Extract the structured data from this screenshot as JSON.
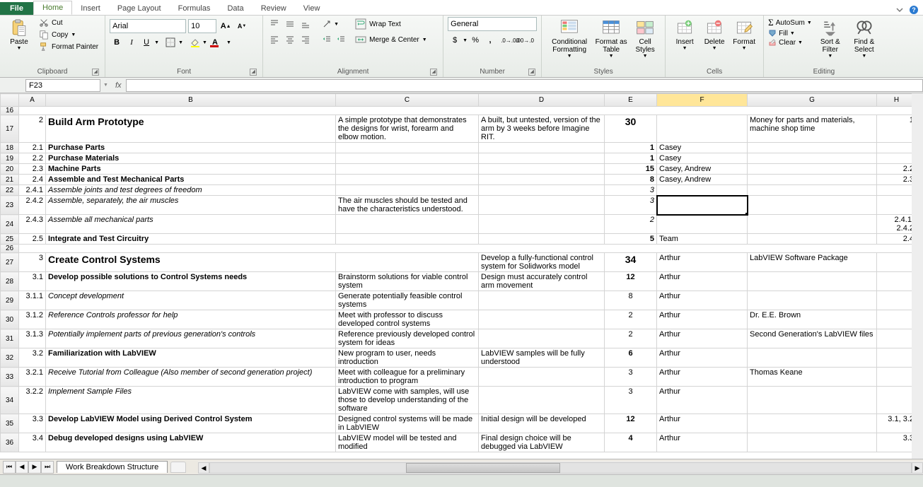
{
  "tabs": {
    "file": "File",
    "home": "Home",
    "insert": "Insert",
    "page_layout": "Page Layout",
    "formulas": "Formulas",
    "data": "Data",
    "review": "Review",
    "view": "View"
  },
  "clipboard": {
    "paste": "Paste",
    "cut": "Cut",
    "copy": "Copy",
    "format_painter": "Format Painter",
    "group": "Clipboard"
  },
  "font": {
    "name": "Arial",
    "size": "10",
    "group": "Font"
  },
  "alignment": {
    "wrap": "Wrap Text",
    "merge": "Merge & Center",
    "group": "Alignment"
  },
  "number": {
    "format": "General",
    "group": "Number"
  },
  "styles": {
    "cond": "Conditional Formatting",
    "table": "Format as Table",
    "cell": "Cell Styles",
    "group": "Styles"
  },
  "cells": {
    "insert": "Insert",
    "delete": "Delete",
    "format": "Format",
    "group": "Cells"
  },
  "editing": {
    "autosum": "AutoSum",
    "fill": "Fill",
    "clear": "Clear",
    "sort": "Sort & Filter",
    "find": "Find & Select",
    "group": "Editing"
  },
  "namebox": "F23",
  "sheet_tab": "Work Breakdown Structure",
  "cols": [
    "",
    "A",
    "B",
    "C",
    "D",
    "E",
    "F",
    "G",
    "H"
  ],
  "rows": [
    {
      "r": "16",
      "hatch": true
    },
    {
      "r": "17",
      "A": "2",
      "B": "Build Arm Prototype",
      "B_cls": "big",
      "C": "A simple prototype that demonstrates the designs for wrist, forearm and elbow motion.",
      "D": "A built, but untested, version of the arm by 3 weeks before Imagine RIT.",
      "E": "30",
      "E_cls": "biggerE",
      "G": "Money for parts and materials, machine shop time",
      "H": "1"
    },
    {
      "r": "18",
      "A": "2.1",
      "B": "Purchase Parts",
      "B_cls": "bold",
      "E": "1",
      "E_cls": "num bold",
      "F": "Casey"
    },
    {
      "r": "19",
      "A": "2.2",
      "B": "Purchase Materials",
      "B_cls": "bold",
      "E": "1",
      "E_cls": "num bold",
      "F": "Casey"
    },
    {
      "r": "20",
      "A": "2.3",
      "B": "Machine Parts",
      "B_cls": "bold",
      "E": "15",
      "E_cls": "num bold",
      "F": "Casey, Andrew",
      "H": "2.2"
    },
    {
      "r": "21",
      "A": "2.4",
      "B": "Assemble and Test Mechanical Parts",
      "B_cls": "bold",
      "E": "8",
      "E_cls": "num bold",
      "F": "Casey, Andrew",
      "H": "2.3"
    },
    {
      "r": "22",
      "A": "2.4.1",
      "B": "Assemble joints and test degrees of freedom",
      "B_cls": "ital indent",
      "E": "3",
      "E_cls": "num ital"
    },
    {
      "r": "23",
      "A": "2.4.2",
      "B": "Assemble, separately, the air muscles",
      "B_cls": "ital indent",
      "C": "The air muscles should be tested and have the characteristics understood.",
      "E": "3",
      "E_cls": "num ital",
      "sel": true
    },
    {
      "r": "24",
      "A": "2.4.3",
      "B": "Assemble all mechanical parts",
      "B_cls": "ital indent",
      "E": "2",
      "E_cls": "num ital",
      "H": "2.4.1, 2.4.2"
    },
    {
      "r": "25",
      "A": "2.5",
      "B": "Integrate and Test Circuitry",
      "B_cls": "bold",
      "E": "5",
      "E_cls": "num bold",
      "F": "Team",
      "H": "2.4"
    },
    {
      "r": "26",
      "hatch": true
    },
    {
      "r": "27",
      "A": "3",
      "B": "Create Control Systems",
      "B_cls": "big",
      "D": "Develop a fully-functional control system for Solidworks model",
      "E": "34",
      "E_cls": "biggerE",
      "F": "Arthur",
      "G": "LabVIEW Software Package"
    },
    {
      "r": "28",
      "A": "3.1",
      "B": "Develop possible solutions to Control Systems needs",
      "B_cls": "bold",
      "C": "Brainstorm solutions for viable control system",
      "D": "Design must accurately control arm movement",
      "E": "12",
      "E_cls": "ctr bold",
      "F": "Arthur"
    },
    {
      "r": "29",
      "A": "3.1.1",
      "B": "Concept development",
      "B_cls": "ital indent",
      "C": "Generate potentially feasible control systems",
      "E": "8",
      "E_cls": "ctr",
      "F": "Arthur"
    },
    {
      "r": "30",
      "A": "3.1.2",
      "B": "Reference Controls professor for help",
      "B_cls": "ital indent",
      "C": "Meet with professor to discuss developed control systems",
      "E": "2",
      "E_cls": "ctr",
      "F": "Arthur",
      "G": "Dr. E.E. Brown"
    },
    {
      "r": "31",
      "A": "3.1.3",
      "B": "Potentially implement parts of previous generation's controls",
      "B_cls": "ital indent",
      "C": "Reference previously developed control system for ideas",
      "E": "2",
      "E_cls": "ctr",
      "F": "Arthur",
      "G": "Second Generation's LabVIEW files"
    },
    {
      "r": "32",
      "A": "3.2",
      "B": "Familiarization with LabVIEW",
      "B_cls": "bold",
      "C": "New program to user, needs introduction",
      "D": "LabVIEW samples will be fully understood",
      "E": "6",
      "E_cls": "ctr bold",
      "F": "Arthur"
    },
    {
      "r": "33",
      "A": "3.2.1",
      "B": "Receive Tutorial from Colleague (Also member of second generation project)",
      "B_cls": "ital indent",
      "C": "Meet with colleague for a preliminary introduction to program",
      "E": "3",
      "E_cls": "ctr",
      "F": "Arthur",
      "G": "Thomas Keane"
    },
    {
      "r": "34",
      "A": "3.2.2",
      "B": "Implement Sample Files",
      "B_cls": "ital indent",
      "C": "LabVIEW come with samples, will use those to develop understanding of the software",
      "E": "3",
      "E_cls": "ctr",
      "F": "Arthur"
    },
    {
      "r": "35",
      "A": "3.3",
      "B": "Develop LabVIEW Model using Derived Control System",
      "B_cls": "bold",
      "C": "Designed control systems will be made in LabVIEW",
      "D": "Initial design will be developed",
      "E": "12",
      "E_cls": "ctr bold",
      "F": "Arthur",
      "H": "3.1, 3.2"
    },
    {
      "r": "36",
      "A": "3.4",
      "B": "Debug developed designs using LabVIEW",
      "B_cls": "bold",
      "C": "LabVIEW model will be tested and modified",
      "D": "Final design choice will be debugged via LabVIEW",
      "E": "4",
      "E_cls": "ctr bold",
      "F": "Arthur",
      "H": "3.3"
    }
  ]
}
